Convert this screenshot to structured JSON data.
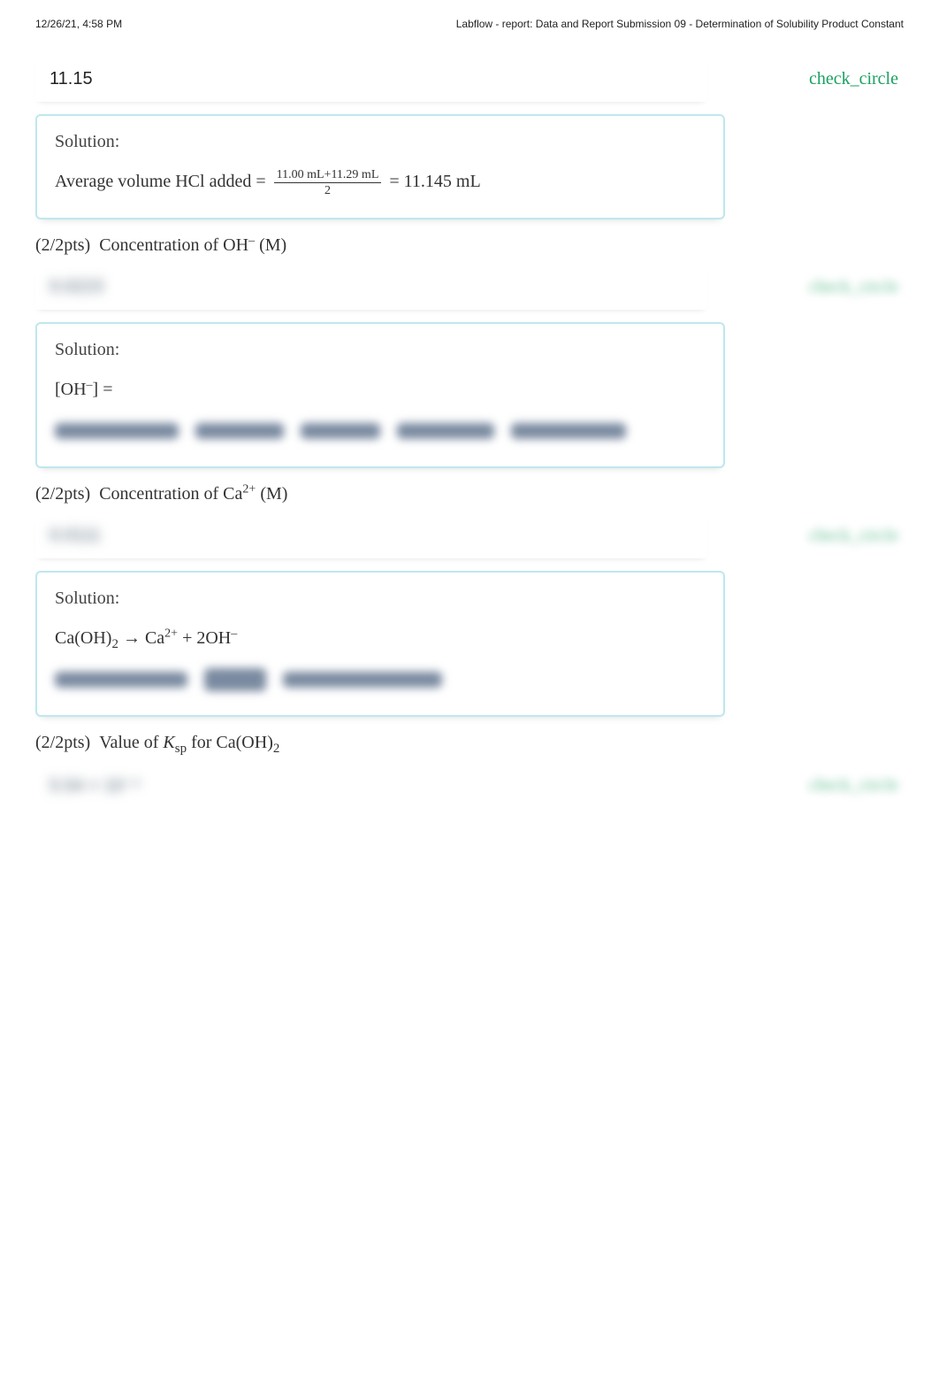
{
  "header": {
    "timestamp": "12/26/21, 4:58 PM",
    "title": "Labflow - report: Data and Report Submission 09 - Determination of Solubility Product Constant"
  },
  "q1": {
    "answer": "11.15",
    "status": "check_circle",
    "solution_label": "Solution:",
    "solution_prefix": "Average volume HCl added = ",
    "frac_num": "11.00 mL+11.29 mL",
    "frac_den": "2",
    "solution_suffix": " = 11.145 mL"
  },
  "q2": {
    "points": "(2/2pts)",
    "title_html": "Concentration of OH⁻ (M)",
    "answer_hidden": "0.0223",
    "status": "check_circle",
    "solution_label": "Solution:",
    "line1": "[OH⁻] ="
  },
  "q3": {
    "points": "(2/2pts)",
    "title_html": "Concentration of Ca²⁺ (M)",
    "answer_hidden": "0.0111",
    "status": "check_circle",
    "solution_label": "Solution:",
    "reaction": "Ca(OH)₂ → Ca²⁺ + 2OH⁻"
  },
  "q4": {
    "points": "(2/2pts)",
    "title_prefix": "Value of ",
    "title_ksp": "K",
    "title_ksp_sub": "sp",
    "title_suffix": " for Ca(OH)₂",
    "answer_hidden": "5.54 × 10⁻⁶",
    "status": "check_circle"
  }
}
